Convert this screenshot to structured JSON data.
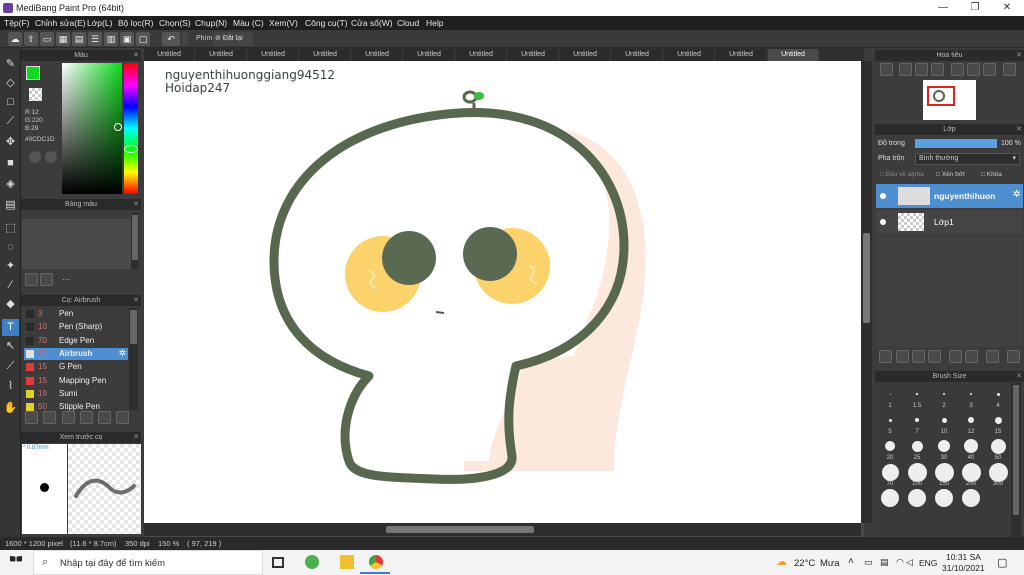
{
  "window": {
    "title": "MediBang Paint Pro (64bit)",
    "minimize": "—",
    "restore": "❐",
    "close": "✕"
  },
  "menu": [
    "Tệp(F)",
    "Chỉnh sửa(E)",
    "Lớp(L)",
    "Bộ lọc(R)",
    "Chọn(S)",
    "Chụp(N)",
    "Màu (C)",
    "Xem(V)",
    "Công cụ(T)",
    "Cửa sổ(W)",
    "Cloud",
    "Help"
  ],
  "toolbar": {
    "keys_label": "Phím",
    "reset_label": "Đặt lại"
  },
  "tabs": [
    "Untitled",
    "Untitled",
    "Untitled",
    "Untitled",
    "Untitled",
    "Untitled",
    "Untitled",
    "Untitled",
    "Untitled",
    "Untitled",
    "Untitled",
    "Untitled",
    "Untitled"
  ],
  "color_panel": {
    "title": "Màu",
    "r": "R:12",
    "g": "G:220",
    "b": "B:29",
    "hex": "#0CDC1D",
    "primary": "#0cdc1d"
  },
  "palette_panel": {
    "title": "Bảng màu",
    "ellipsis": "···",
    "swatches": [
      "#000000",
      "#3a2f3f",
      "#7a3b3b",
      "#e8c8c0",
      "#f3e0d8",
      "#c9b8b8",
      "#5b6b5b",
      "#3f7f3f",
      "#f0d0d8",
      "#e0e0e0",
      "#c84060"
    ]
  },
  "brush_panel": {
    "title": "Cọ: Airbrush",
    "items": [
      {
        "size": "3",
        "name": "Pen",
        "color": "#2a2a2a"
      },
      {
        "size": "10",
        "name": "Pen (Sharp)",
        "color": "#2a2a2a"
      },
      {
        "size": "70",
        "name": "Edge Pen",
        "color": "#2a2a2a"
      },
      {
        "size": "12",
        "name": "Airbrush",
        "color": "#e0e0e0"
      },
      {
        "size": "15",
        "name": "G Pen",
        "color": "#e03a3a"
      },
      {
        "size": "15",
        "name": "Mapping Pen",
        "color": "#e03a3a"
      },
      {
        "size": "19",
        "name": "Sumi",
        "color": "#e0d030"
      },
      {
        "size": "50",
        "name": "Stipple Pen",
        "color": "#e0d030"
      }
    ]
  },
  "preview_panel": {
    "title": "Xem trước cọ",
    "size": "* 0.87mm"
  },
  "canvas_text": {
    "line1": "nguyenthihuonggiang94512",
    "line2": "Hoidap247"
  },
  "navigator": {
    "title": "Hoa tiêu"
  },
  "layer_panel": {
    "title": "Lớp",
    "opacity_label": "Độ trong",
    "opacity_value": "100 %",
    "blend_label": "Pha trộn",
    "blend_value": "Bình thường",
    "protect_alpha": "Bảo vệ alpha",
    "clip": "Xén bớt",
    "lock": "Khóa",
    "layers": [
      "nguyenthihuon",
      "Lớp1"
    ]
  },
  "brush_size_panel": {
    "title": "Brush Size",
    "sizes": [
      "1",
      "1.5",
      "2",
      "3",
      "4",
      "5",
      "7",
      "10",
      "12",
      "15",
      "20",
      "25",
      "30",
      "40",
      "50",
      "70",
      "100",
      "150",
      "200",
      "300",
      "",
      "",
      "",
      ""
    ]
  },
  "status": {
    "pixels": "1600 * 1200 pixel",
    "cm": "(11.6 * 8.7cm)",
    "dpi": "350 dpi",
    "zoom": "150 %",
    "pos": "( 97, 219 )"
  },
  "taskbar": {
    "search_placeholder": "Nhập tại đây để tìm kiếm",
    "weather": "22°C",
    "weather_desc": "Mưa",
    "lang": "ENG",
    "time": "10:31 SA",
    "date": "31/10/2021"
  },
  "colors": {
    "skull_outline": "#57684f",
    "eye_fill": "#fcd36a",
    "pupil": "#5a6a52",
    "blush": "#fde8de"
  }
}
